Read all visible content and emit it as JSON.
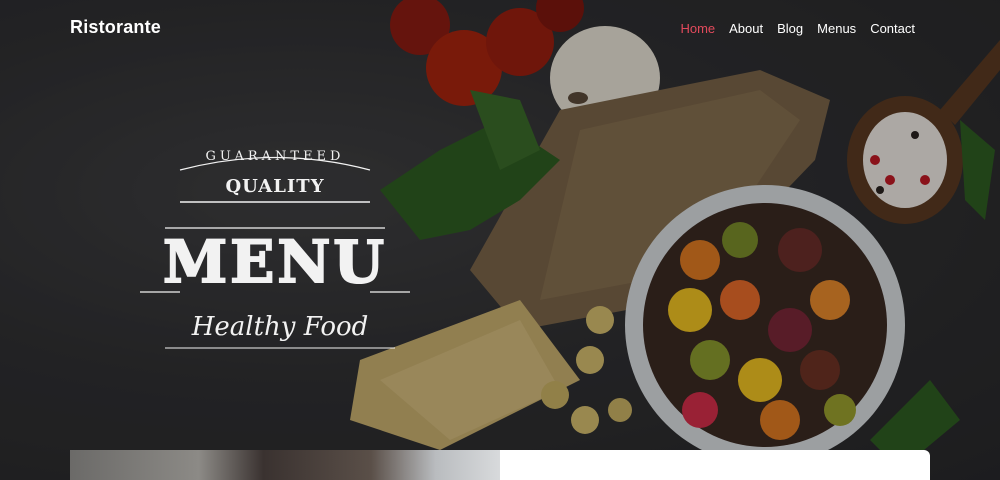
{
  "navbar": {
    "brand": "Ristorante",
    "items": [
      {
        "label": "Home",
        "active": true
      },
      {
        "label": "About",
        "active": false
      },
      {
        "label": "Blog",
        "active": false
      },
      {
        "label": "Menus",
        "active": false
      },
      {
        "label": "Contact",
        "active": false
      }
    ]
  },
  "hero": {
    "logo": {
      "top": "GUARANTEED",
      "quality": "QUALITY",
      "main": "MENU",
      "script": "Healthy Food"
    }
  },
  "colors": {
    "accent": "#e24a5c",
    "background": "#2b2b2d",
    "text": "#ffffff"
  }
}
